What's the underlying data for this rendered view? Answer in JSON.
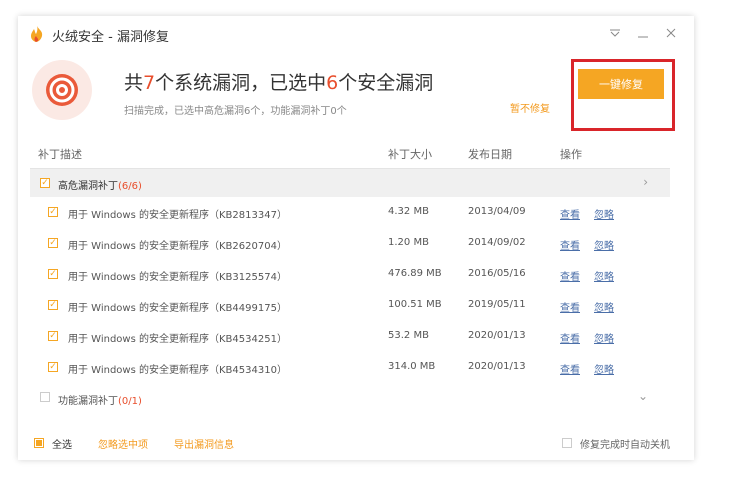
{
  "window": {
    "title": "火绒安全 - 漏洞修复",
    "icons": {
      "logo": "flame-logo-icon",
      "menu": "chevron-down-icon",
      "minimize": "minimize-icon",
      "close": "close-icon"
    }
  },
  "header": {
    "line_1": "共",
    "total": "7",
    "line_2": "个系统漏洞，已选中",
    "selected": "6",
    "line_3": "个安全漏洞",
    "subtitle": "扫描完成，已选中高危漏洞6个，功能漏洞补丁0个",
    "skip_label": "暂不修复",
    "fix_label": "一键修复",
    "accent": "#f5a623",
    "highlight_color": "#d9252a"
  },
  "table": {
    "columns": [
      "补丁描述",
      "补丁大小",
      "发布日期",
      "操作"
    ],
    "groups": [
      {
        "label": "高危漏洞补丁",
        "count": "(6/6)",
        "rows": [
          {
            "desc": "用于 Windows 的安全更新程序（KB2813347）",
            "size": "4.32 MB",
            "date": "2013/04/09",
            "view": "查看",
            "ignore": "忽略"
          },
          {
            "desc": "用于 Windows 的安全更新程序（KB2620704）",
            "size": "1.20 MB",
            "date": "2014/09/02",
            "view": "查看",
            "ignore": "忽略"
          },
          {
            "desc": "用于 Windows 的安全更新程序（KB3125574）",
            "size": "476.89 MB",
            "date": "2016/05/16",
            "view": "查看",
            "ignore": "忽略"
          },
          {
            "desc": "用于 Windows 的安全更新程序（KB4499175）",
            "size": "100.51 MB",
            "date": "2019/05/11",
            "view": "查看",
            "ignore": "忽略"
          },
          {
            "desc": "用于 Windows 的安全更新程序（KB4534251）",
            "size": "53.2 MB",
            "date": "2020/01/13",
            "view": "查看",
            "ignore": "忽略"
          },
          {
            "desc": "用于 Windows 的安全更新程序（KB4534310）",
            "size": "314.0 MB",
            "date": "2020/01/13",
            "view": "查看",
            "ignore": "忽略"
          }
        ]
      },
      {
        "label": "功能漏洞补丁",
        "count": "(0/1)"
      }
    ]
  },
  "footer": {
    "select_all": "全选",
    "ignore_selected": "忽略选中项",
    "export": "导出漏洞信息",
    "auto_shutdown": "修复完成时自动关机"
  }
}
